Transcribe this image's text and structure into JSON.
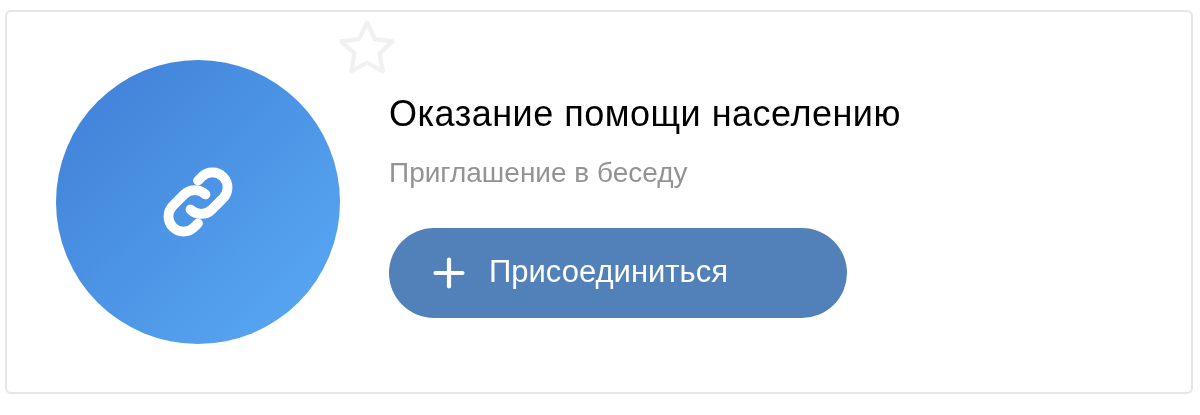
{
  "chat": {
    "title": "Оказание помощи населению",
    "subtitle": "Приглашение в беседу"
  },
  "join_button": {
    "label": "Присоединиться"
  }
}
